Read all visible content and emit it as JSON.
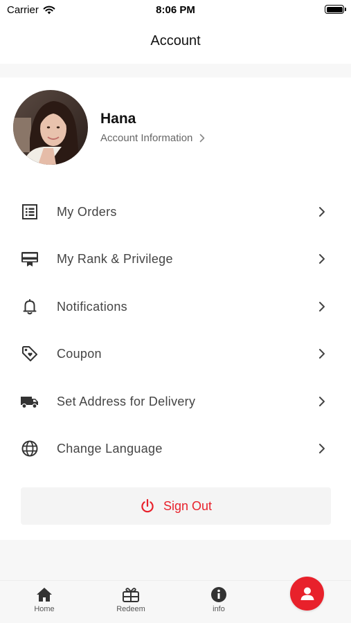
{
  "status_bar": {
    "carrier": "Carrier",
    "time": "8:06 PM"
  },
  "header": {
    "title": "Account"
  },
  "profile": {
    "name": "Hana",
    "link_label": "Account Information"
  },
  "menu": [
    {
      "label": "My Orders",
      "icon": "orders-list-icon"
    },
    {
      "label": "My Rank & Privilege",
      "icon": "rank-card-icon"
    },
    {
      "label": "Notifications",
      "icon": "bell-icon"
    },
    {
      "label": "Coupon",
      "icon": "tag-icon"
    },
    {
      "label": "Set Address for Delivery",
      "icon": "truck-icon"
    },
    {
      "label": "Change Language",
      "icon": "globe-icon"
    }
  ],
  "sign_out": {
    "label": "Sign Out",
    "icon": "power-icon"
  },
  "tabs": [
    {
      "label": "Home",
      "icon": "home-icon"
    },
    {
      "label": "Redeem",
      "icon": "gift-icon"
    },
    {
      "label": "info",
      "icon": "info-icon"
    }
  ],
  "fab": {
    "icon": "user-icon"
  },
  "colors": {
    "accent": "#e8212b",
    "text": "#444444",
    "secondary_text": "#666666",
    "background": "#f7f7f7"
  }
}
